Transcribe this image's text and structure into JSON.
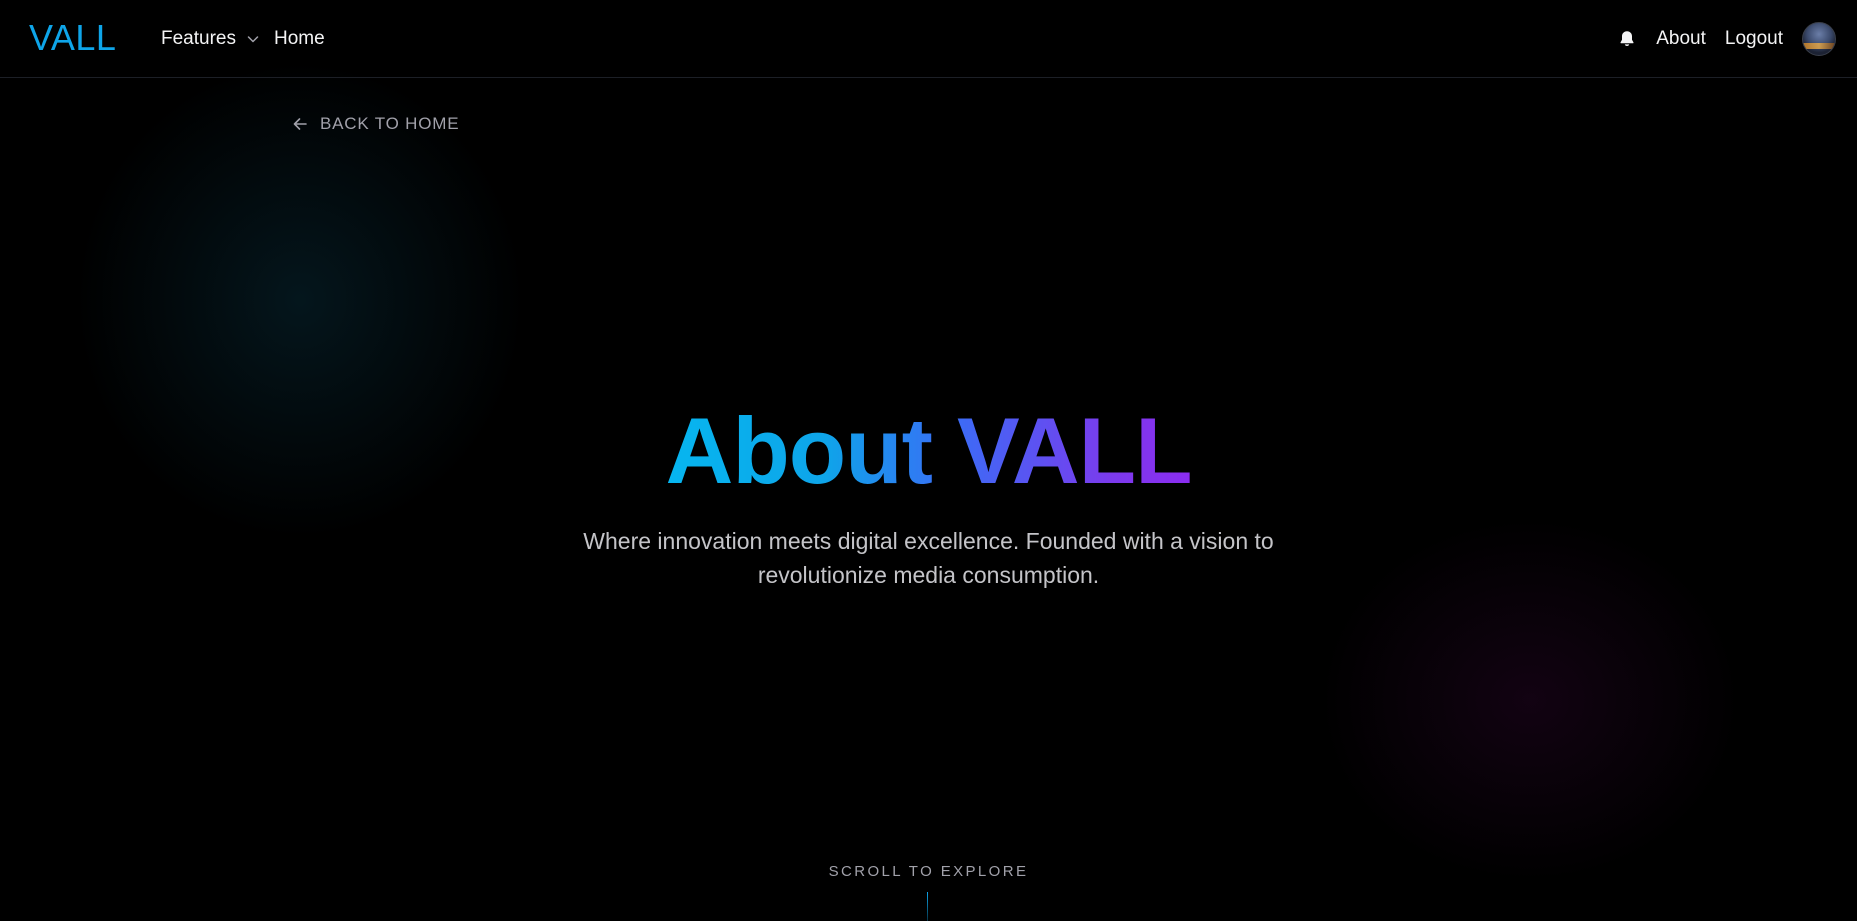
{
  "navbar": {
    "logo": "VALL",
    "features_label": "Features",
    "home_label": "Home",
    "about_label": "About",
    "logout_label": "Logout",
    "icons": {
      "notifications": "bell-icon",
      "features_dropdown": "chevron-down-icon",
      "profile": "avatar"
    }
  },
  "back_link": {
    "label": "BACK TO HOME",
    "icon": "arrow-left-icon"
  },
  "hero": {
    "title": "About VALL",
    "subtitle_line1": "Where innovation meets digital excellence. Founded with a vision to",
    "subtitle_line2": "revolutionize media consumption."
  },
  "scroll_hint": {
    "label": "SCROLL TO EXPLORE"
  },
  "colors": {
    "background": "#000000",
    "accent": "#0ea5e9",
    "gradient_start": "#06b6f0",
    "gradient_end": "#8b2cf0",
    "text_primary": "#f4f4f5",
    "text_muted": "#a1a1aa"
  }
}
